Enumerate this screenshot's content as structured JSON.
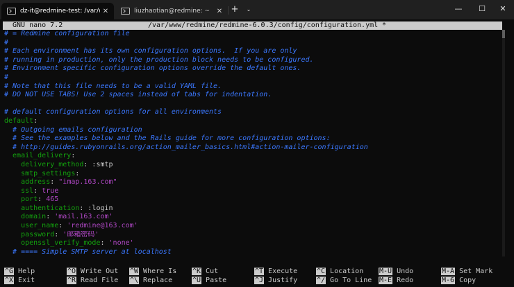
{
  "tabs": [
    {
      "title": "dz-it@redmine-test: /var/www",
      "close": "✕"
    },
    {
      "title": "liuzhaotian@redmine: ~",
      "close": "✕"
    }
  ],
  "tabbar": {
    "add": "+",
    "menu": "⌄"
  },
  "window_controls": {
    "minimize": "—",
    "maximize": "☐",
    "close": "✕"
  },
  "nano": {
    "version": "GNU nano 7.2",
    "filepath": "/var/www/redmine/redmine-6.0.3/config/configuration.yml",
    "modified": "*"
  },
  "editor": {
    "lines": [
      {
        "segs": [
          {
            "c": "c",
            "t": "# = Redmine configuration file"
          }
        ]
      },
      {
        "segs": [
          {
            "c": "c",
            "t": "#"
          }
        ]
      },
      {
        "segs": [
          {
            "c": "c",
            "t": "# Each environment has its own configuration options.  If you are only"
          }
        ]
      },
      {
        "segs": [
          {
            "c": "c",
            "t": "# running in production, only the production block needs to be configured."
          }
        ]
      },
      {
        "segs": [
          {
            "c": "c",
            "t": "# Environment specific configuration options override the default ones."
          }
        ]
      },
      {
        "segs": [
          {
            "c": "c",
            "t": "#"
          }
        ]
      },
      {
        "segs": [
          {
            "c": "c",
            "t": "# Note that this file needs to be a valid YAML file."
          }
        ]
      },
      {
        "segs": [
          {
            "c": "c",
            "t": "# DO NOT USE TABS! Use 2 spaces instead of tabs for indentation."
          }
        ]
      },
      {
        "segs": []
      },
      {
        "segs": [
          {
            "c": "c",
            "t": "# default configuration options for all environments"
          }
        ]
      },
      {
        "segs": [
          {
            "c": "k",
            "t": "default"
          },
          {
            "c": "n",
            "t": ":"
          }
        ]
      },
      {
        "segs": [
          {
            "c": "c",
            "t": "  # Outgoing emails configuration"
          }
        ]
      },
      {
        "segs": [
          {
            "c": "c",
            "t": "  # See the examples below and the Rails guide for more configuration options:"
          }
        ]
      },
      {
        "segs": [
          {
            "c": "c",
            "t": "  # http://guides.rubyonrails.org/action_mailer_basics.html#action-mailer-configuration"
          }
        ]
      },
      {
        "segs": [
          {
            "c": "k",
            "t": "  email_delivery"
          },
          {
            "c": "n",
            "t": ":"
          }
        ]
      },
      {
        "segs": [
          {
            "c": "k",
            "t": "    delivery_method"
          },
          {
            "c": "n",
            "t": ": :smtp"
          }
        ]
      },
      {
        "segs": [
          {
            "c": "k",
            "t": "    smtp_settings"
          },
          {
            "c": "n",
            "t": ":"
          }
        ]
      },
      {
        "segs": [
          {
            "c": "k",
            "t": "    address"
          },
          {
            "c": "n",
            "t": ": "
          },
          {
            "c": "s",
            "t": "\"imap.163.com\""
          }
        ]
      },
      {
        "segs": [
          {
            "c": "k",
            "t": "    ssl"
          },
          {
            "c": "n",
            "t": ": "
          },
          {
            "c": "s",
            "t": "true"
          }
        ]
      },
      {
        "segs": [
          {
            "c": "k",
            "t": "    port"
          },
          {
            "c": "n",
            "t": ": "
          },
          {
            "c": "s",
            "t": "465"
          }
        ]
      },
      {
        "segs": [
          {
            "c": "k",
            "t": "    authentication"
          },
          {
            "c": "n",
            "t": ": :login"
          }
        ]
      },
      {
        "segs": [
          {
            "c": "k",
            "t": "    domain"
          },
          {
            "c": "n",
            "t": ": "
          },
          {
            "c": "s",
            "t": "'mail.163.com'"
          }
        ]
      },
      {
        "segs": [
          {
            "c": "k",
            "t": "    user_name"
          },
          {
            "c": "n",
            "t": ": "
          },
          {
            "c": "s",
            "t": "'redmine@163.com'"
          }
        ]
      },
      {
        "segs": [
          {
            "c": "k",
            "t": "    password"
          },
          {
            "c": "n",
            "t": ": "
          },
          {
            "c": "s",
            "t": "'邮箱密码'"
          }
        ]
      },
      {
        "segs": [
          {
            "c": "k",
            "t": "    openssl_verify_mode"
          },
          {
            "c": "n",
            "t": ": "
          },
          {
            "c": "s",
            "t": "'none'"
          }
        ]
      },
      {
        "segs": [
          {
            "c": "c",
            "t": "  # ==== Simple SMTP server at localhost"
          }
        ]
      }
    ]
  },
  "shortcuts": [
    {
      "key": "^G",
      "label": "Help"
    },
    {
      "key": "^X",
      "label": "Exit"
    },
    {
      "key": "^O",
      "label": "Write Out"
    },
    {
      "key": "^R",
      "label": "Read File"
    },
    {
      "key": "^W",
      "label": "Where Is"
    },
    {
      "key": "^\\",
      "label": "Replace"
    },
    {
      "key": "^K",
      "label": "Cut"
    },
    {
      "key": "^U",
      "label": "Paste"
    },
    {
      "key": "^T",
      "label": "Execute"
    },
    {
      "key": "^J",
      "label": "Justify"
    },
    {
      "key": "^C",
      "label": "Location"
    },
    {
      "key": "^/",
      "label": "Go To Line"
    },
    {
      "key": "M-U",
      "label": "Undo"
    },
    {
      "key": "M-E",
      "label": "Redo"
    },
    {
      "key": "M-A",
      "label": "Set Mark"
    },
    {
      "key": "M-6",
      "label": "Copy"
    }
  ]
}
